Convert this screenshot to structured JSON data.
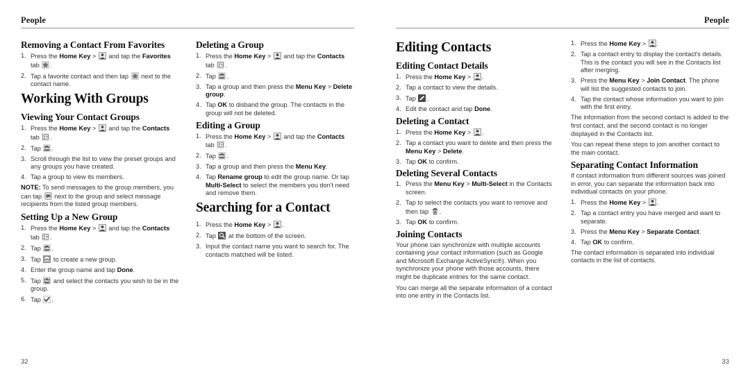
{
  "spread": {
    "left_page": {
      "running_head": "People",
      "page_number": "32",
      "col1": {
        "h_removing": "Removing a Contact From Favorites",
        "removing_steps": [
          "Press the Home Key > [contacts-app-icon] and tap the Favorites tab [star-icon].",
          "Tap a favorite contact and then tap [star-icon] next to the contact name."
        ],
        "h_working": "Working With Groups",
        "h_viewing": "Viewing Your Contact Groups",
        "viewing_steps": [
          "Press the Home Key > [contacts-app-icon] and tap the Contacts tab [contacts-tab-icon].",
          "Tap [groups-icon].",
          "Scroll through the list to view the preset groups and any groups you have created.",
          "Tap a group to view its members."
        ],
        "note_label": "NOTE:",
        "note_text": " To send messages to the group members, you can tap [message-group-icon] next to the group and select message recipients from the listed group members.",
        "h_setting": "Setting Up a New Group",
        "setting_steps": [
          "Press the Home Key > [contacts-app-icon] and tap the Contacts tab [contacts-tab-icon].",
          "Tap [groups-icon].",
          "Tap [new-group-icon] to create a new group.",
          "Enter the group name and tap Done.",
          "Tap [add-members-icon] and select the contacts you wish to be in the group.",
          "Tap [checkmark-icon]."
        ]
      },
      "col2": {
        "h_deleting_group": "Deleting a Group",
        "deleting_group_steps": [
          "Press the Home Key > [contacts-app-icon] and tap the Contacts tab [contacts-tab-icon].",
          "Tap [groups-icon].",
          "Tap a group and then press the Menu Key > Delete group.",
          "Tap OK to disband the group. The contacts in the group will not be deleted."
        ],
        "h_editing_group": "Editing a Group",
        "editing_group_steps": [
          "Press the Home Key > [contacts-app-icon] and tap the Contacts tab [contacts-tab-icon].",
          "Tap [groups-icon].",
          "Tap a group and then press the Menu Key.",
          "Tap Rename group to edit the group name. Or tap Multi-Select to select the members you don't need and remove them."
        ],
        "h_searching": "Searching for a Contact",
        "searching_steps": [
          "Press the Home Key > [contacts-app-icon].",
          "Tap [search-icon] at the bottom of the screen.",
          "Input the contact name you want to search for. The contacts matched will be listed."
        ]
      }
    },
    "right_page": {
      "running_head": "People",
      "page_number": "33",
      "col1": {
        "h_editing_contacts": "Editing Contacts",
        "h_editing_details": "Editing Contact Details",
        "editing_details_steps": [
          "Press the Home Key > [contacts-app-icon].",
          "Tap a contact to view the details.",
          "Tap [edit-pencil-icon].",
          "Edit the contact and tap Done."
        ],
        "h_deleting_contact": "Deleting a Contact",
        "deleting_contact_steps": [
          "Press the Home Key > [contacts-app-icon].",
          "Tap a contact you want to delete and then press the Menu Key > Delete.",
          "Tap OK to confirm."
        ],
        "h_deleting_several": "Deleting Several Contacts",
        "deleting_several_steps": [
          "Press the Menu Key > Multi-Select in the Contacts screen.",
          "Tap to select the contacts you want to remove and then tap [trash-icon].",
          "Tap OK to confirm."
        ],
        "h_joining": "Joining Contacts",
        "joining_p1": "Your phone can synchronize with multiple accounts containing your contact information (such as Google and Microsoft Exchange ActiveSync®). When you synchronize your phone with those accounts, there might be duplicate entries for the same contact.",
        "joining_p2": "You can merge all the separate information of a contact into one entry in the Contacts list."
      },
      "col2": {
        "joining_steps": [
          "Press the Home Key > [contacts-app-icon].",
          "Tap a contact entry to display the contact's details. This is the contact you will see in the Contacts list after merging.",
          "Press the Menu Key > Join Contact. The phone will list the suggested contacts to join.",
          "Tap the contact whose information you want to join with the first entry."
        ],
        "joining_after_p1": "The information from the second contact is added to the first contact, and the second contact is no longer displayed in the Contacts list.",
        "joining_after_p2": "You can repeat these steps to join another contact to the main contact.",
        "h_separating": "Separating Contact Information",
        "separating_intro": "If contact information from different sources was joined in error, you can separate the information back into individual contacts on your phone.",
        "separating_steps": [
          "Press the Home Key > [contacts-app-icon].",
          "Tap a contact entry you have merged and want to separate.",
          "Press the Menu Key > Separate Contact.",
          "Tap OK to confirm."
        ],
        "separating_after": "The contact information is separated into individual contacts in the list of contacts."
      }
    }
  },
  "icons": {
    "contacts-app-icon": "contacts-app-icon",
    "star-icon": "star-icon",
    "contacts-tab-icon": "contacts-tab-icon",
    "groups-icon": "groups-icon",
    "new-group-icon": "new-group-icon",
    "add-members-icon": "add-members-icon",
    "checkmark-icon": "checkmark-icon",
    "message-group-icon": "message-group-icon",
    "search-icon": "search-icon",
    "edit-pencil-icon": "edit-pencil-icon",
    "trash-icon": "trash-icon"
  },
  "colors": {
    "text": "#333333",
    "heading": "#111111",
    "rule": "#8d8d8d",
    "icon_fill": "#6b6b6b",
    "icon_bg": "#d8d8d8"
  }
}
